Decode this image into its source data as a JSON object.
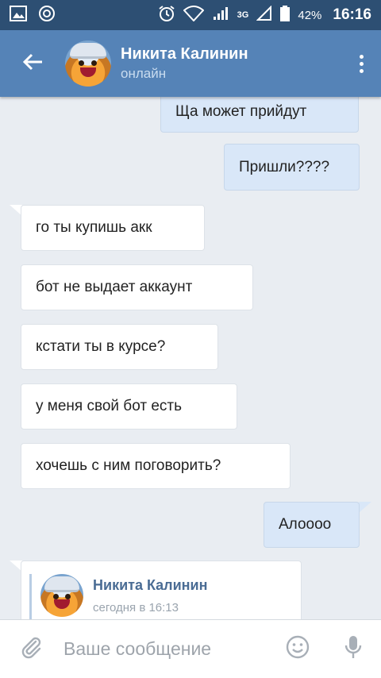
{
  "status_bar": {
    "battery_percent": "42%",
    "time": "16:16",
    "network": "3G"
  },
  "header": {
    "contact_name": "Никита Калинин",
    "contact_status": "онлайн"
  },
  "messages": [
    {
      "direction": "out",
      "text": "Ща может прийдут"
    },
    {
      "direction": "out",
      "text": "Пришли????"
    },
    {
      "direction": "in",
      "text": "го ты купишь акк"
    },
    {
      "direction": "in",
      "text": "бот не выдает аккаунт"
    },
    {
      "direction": "in",
      "text": "кстати ты в курсе?"
    },
    {
      "direction": "in",
      "text": "у меня свой бот есть"
    },
    {
      "direction": "in",
      "text": "хочешь с ним поговорить?"
    },
    {
      "direction": "out",
      "text": "Алоооо"
    }
  ],
  "forwarded": {
    "name": "Никита Калинин",
    "time": "сегодня в 16:13"
  },
  "composer": {
    "placeholder": "Ваше сообщение"
  },
  "colors": {
    "status_bar": "#2d4f73",
    "header": "#5583b7",
    "background": "#e9edf2",
    "outgoing_bubble": "#d9e7f8",
    "incoming_bubble": "#ffffff"
  }
}
